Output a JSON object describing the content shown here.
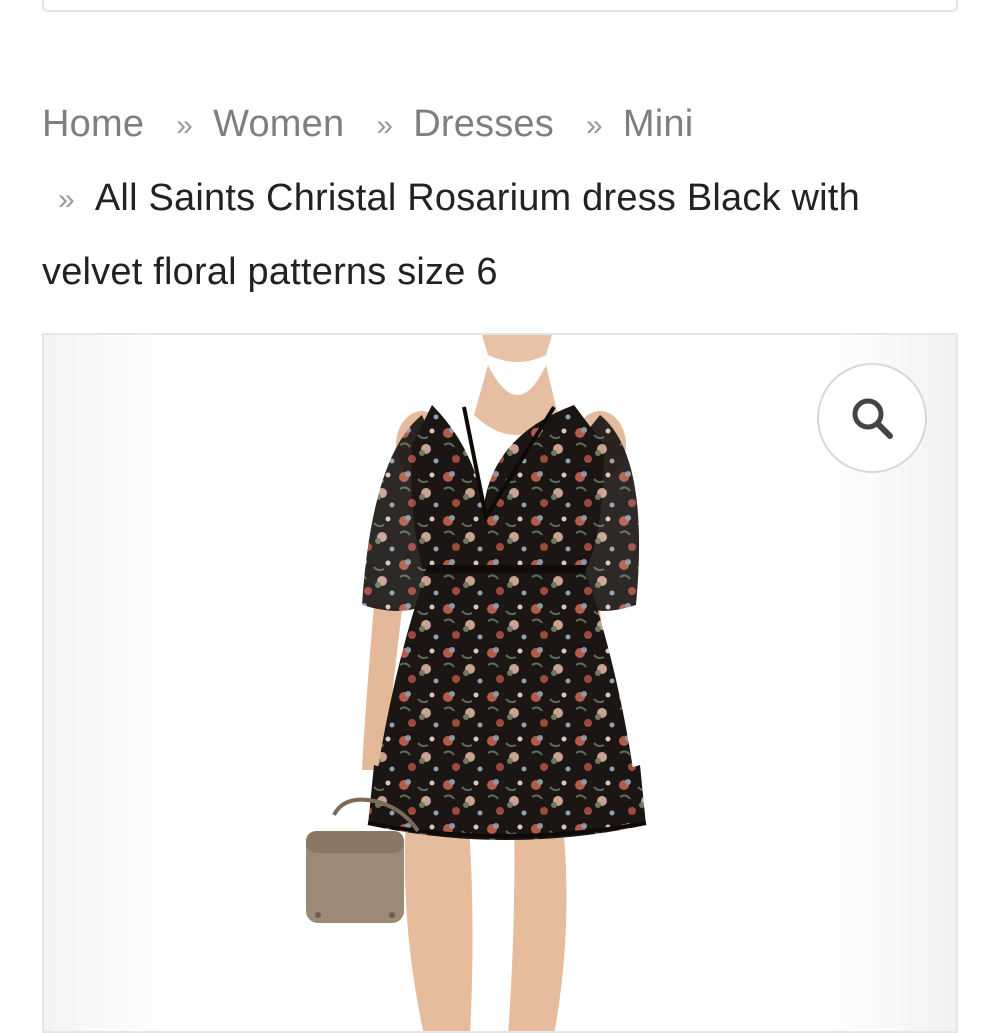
{
  "breadcrumb": {
    "items": [
      {
        "label": "Home"
      },
      {
        "label": "Women"
      },
      {
        "label": "Dresses"
      },
      {
        "label": "Mini"
      }
    ],
    "separator": "»",
    "current": "All Saints Christal Rosarium dress Black with velvet floral patterns size 6"
  },
  "icons": {
    "zoom": "search-icon"
  },
  "colors": {
    "breadcrumb_link": "#7f7f7f",
    "breadcrumb_current": "#222222",
    "border": "#e6e6e6"
  }
}
